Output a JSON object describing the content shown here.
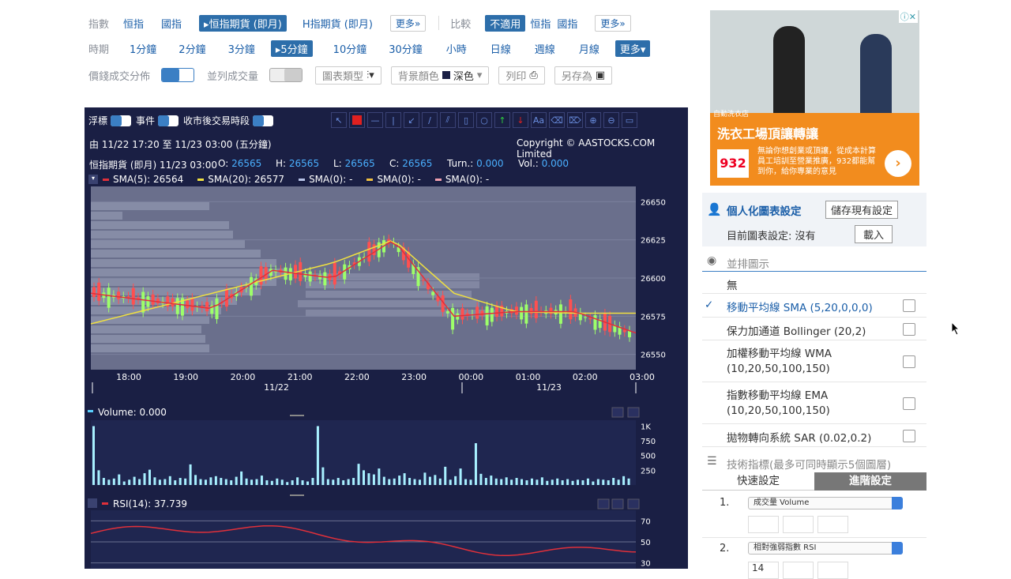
{
  "toolbar": {
    "row1": {
      "label": "指數",
      "items": [
        "恒指",
        "國指"
      ],
      "selected": "恒指期貨 (即月)",
      "after": "H指期貨 (即月)",
      "more": "更多",
      "compare_label": "比較",
      "compare_selected": "不適用",
      "compare_items": [
        "恒指",
        "國指"
      ],
      "compare_more": "更多"
    },
    "row2": {
      "label": "時期",
      "items_before": [
        "1分鐘",
        "2分鐘",
        "3分鐘"
      ],
      "selected": "5分鐘",
      "items_after": [
        "10分鐘",
        "30分鐘",
        "小時",
        "日線",
        "週線",
        "月線"
      ],
      "more": "更多"
    },
    "row3": {
      "dist_label": "價錢成交分佈",
      "vol_label": "並列成交量",
      "type_label": "圖表類型",
      "bg_label": "背景顏色",
      "bg_value": "深色",
      "print_label": "列印",
      "save_label": "另存為"
    }
  },
  "chart": {
    "float_label": "浮標",
    "event_label": "事件",
    "after_hours_label": "收市後交易時段",
    "range": "由  11/22 17:20 至  11/23 03:00 (五分鐘)",
    "copyright": "Copyright © AASTOCKS.COM Limited",
    "ohlc": {
      "name": "恒指期貨 (即月) 11/23 03:00",
      "o_label": "O:",
      "o": "26565",
      "h_label": "H:",
      "h": "26565",
      "l_label": "L:",
      "l": "26565",
      "c_label": "C:",
      "c": "26565",
      "turn_label": "Turn.:",
      "turn": "0.000",
      "vol_label": "Vol.:",
      "vol": "0.000"
    },
    "sma": [
      {
        "text": "SMA(5): 26564",
        "color": "#e0303a"
      },
      {
        "text": "SMA(20): 26577",
        "color": "#f0e040"
      },
      {
        "text": "SMA(0): -",
        "color": "#b8c4e8"
      },
      {
        "text": "SMA(0): -",
        "color": "#f0c040"
      },
      {
        "text": "SMA(0): -",
        "color": "#f0a0b0"
      }
    ],
    "volume_label": "Volume: 0.000",
    "rsi_label": "RSI(14): 37.739",
    "dates": [
      "11/22",
      "11/23"
    ]
  },
  "chart_data": [
    {
      "type": "line",
      "title": "恒指期貨 (即月)",
      "x": [
        "18:00",
        "19:00",
        "20:00",
        "21:00",
        "22:00",
        "23:00",
        "00:00",
        "01:00",
        "02:00",
        "03:00"
      ],
      "y_ticks": [
        26650,
        26625,
        26600,
        26575,
        26550
      ],
      "ylim": [
        26540,
        26660
      ],
      "series": [
        {
          "name": "SMA(5)",
          "values": [
            26590,
            26585,
            26580,
            26605,
            26600,
            26625,
            26575,
            26578,
            26578,
            26564
          ]
        },
        {
          "name": "SMA(20)",
          "values": [
            26570,
            26580,
            26590,
            26600,
            26610,
            26625,
            26590,
            26578,
            26577,
            26577
          ]
        }
      ]
    },
    {
      "type": "bar",
      "title": "Volume",
      "y_ticks": [
        "1K",
        "750",
        "500",
        "250"
      ],
      "ylim": [
        0,
        1100
      ]
    },
    {
      "type": "line",
      "title": "RSI(14)",
      "y_ticks": [
        70,
        50,
        30
      ],
      "ylim": [
        20,
        80
      ]
    }
  ],
  "sidebar": {
    "ad_badge": "自動洗衣店",
    "ad_title": "洗衣工場頂讓轉讓",
    "ad_logo": "932",
    "ad_text": "無論你想創業或頂讓，從成本計算員工培訓至營業推廣，932都能幫到你，給你專業的意見",
    "personal_title": "個人化圖表設定",
    "save_current": "儲存現有設定",
    "current_label": "目前圖表設定: 沒有",
    "load": "載入",
    "overlay_title": "並排圖示",
    "overlays": [
      {
        "label": "無",
        "line2": "",
        "checked": false,
        "edit": false
      },
      {
        "label": "移動平均線 SMA (5,20,0,0,0)",
        "line2": "",
        "checked": true,
        "edit": true
      },
      {
        "label": "保力加通道 Bollinger (20,2)",
        "line2": "",
        "checked": false,
        "edit": true
      },
      {
        "label": "加權移動平均線 WMA",
        "line2": "(10,20,50,100,150)",
        "checked": false,
        "edit": true
      },
      {
        "label": "指數移動平均線 EMA",
        "line2": "(10,20,50,100,150)",
        "checked": false,
        "edit": true
      },
      {
        "label": "拋物轉向系統 SAR (0.02,0.2)",
        "line2": "",
        "checked": false,
        "edit": true
      }
    ],
    "tech_title": "技術指標(最多可同時顯示5個圖層)",
    "tab_quick": "快速設定",
    "tab_adv": "進階設定",
    "indicators": [
      {
        "num": "1.",
        "value": "成交量 Volume"
      },
      {
        "num": "2.",
        "value": "相對強弱指數 RSI"
      }
    ],
    "partial_value": "14"
  }
}
